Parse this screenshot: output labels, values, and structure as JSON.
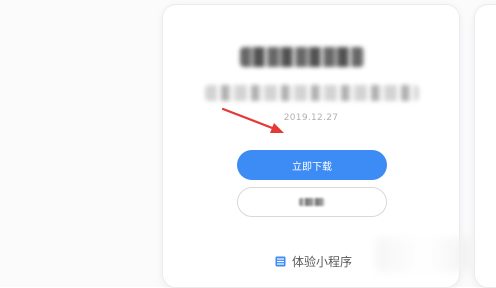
{
  "card": {
    "date": "2019.12.27",
    "primary_button_label": "立即下载",
    "mini_program_label": "体验小程序"
  },
  "colors": {
    "primary": "#3d8bf5",
    "arrow": "#e53935"
  },
  "icons": {
    "mini_program": "list-icon",
    "pointer": "red-arrow-icon"
  }
}
